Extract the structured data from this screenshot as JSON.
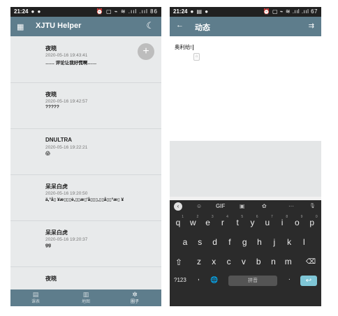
{
  "left": {
    "status": {
      "time": "21:24",
      "dots": "● ●",
      "right": "⏰ ▢ ⌁ ≋ .ııl .ııl 86"
    },
    "appbar": {
      "title": "XJTU Helper",
      "grid_icon": "grid-icon",
      "moon_icon": "moon-icon"
    },
    "fab_label": "+",
    "posts": [
      {
        "name": "夜晓",
        "date": "2020-05-16 19:43:41",
        "body": "…… 评论让我好慌啊……"
      },
      {
        "name": "夜晓",
        "date": "2020-05-16 19:42:57",
        "body": "?????"
      },
      {
        "name": "DNULTRA",
        "date": "2020-05-16 19:22:21",
        "body": "😱"
      },
      {
        "name": "呆呆白虎",
        "date": "2020-05-16 19:20:50",
        "body": "ä,°å▯ ¥æ▯▯▯è,▯▯æ▯'å▯▯▯,▯▯å▯▯°æ▯ ¥"
      },
      {
        "name": "呆呆白虎",
        "date": "2020-05-16 19:20:37",
        "body": "gg"
      },
      {
        "name": "夜晓",
        "date": "",
        "body": ""
      }
    ],
    "nav": [
      {
        "icon": "▤",
        "label": "课表"
      },
      {
        "icon": "▥",
        "label": "地图"
      },
      {
        "icon": "✲",
        "label": "圈子"
      }
    ]
  },
  "right": {
    "status": {
      "time": "21:24",
      "dots": "● ▤ ●",
      "right": "⏰ ▢ ⌁ ≋ .ııl .ııl 67"
    },
    "appbar": {
      "title": "动态",
      "back_icon": "←",
      "send_icon": "⇉"
    },
    "editor": {
      "text": "奥利给!",
      "handle": "⌂"
    },
    "toolbar": {
      "back": "‹",
      "emoji": "☺",
      "gif": "GIF",
      "clipboard": "▣",
      "settings": "✿",
      "more": "···",
      "mic": "🎙"
    },
    "rows": [
      [
        "q",
        "w",
        "e",
        "r",
        "t",
        "y",
        "u",
        "i",
        "o",
        "p"
      ],
      [
        "a",
        "s",
        "d",
        "f",
        "g",
        "h",
        "j",
        "k",
        "l"
      ],
      [
        "z",
        "x",
        "c",
        "v",
        "b",
        "n",
        "m"
      ]
    ],
    "digits": [
      "1",
      "2",
      "3",
      "4",
      "5",
      "6",
      "7",
      "8",
      "9",
      "0"
    ],
    "shift": "⇧",
    "backspace": "⌫",
    "num_key": "?123",
    "comma": ",",
    "globe": "🌐",
    "space": "拼音",
    "period": ".",
    "enter": "↩"
  }
}
